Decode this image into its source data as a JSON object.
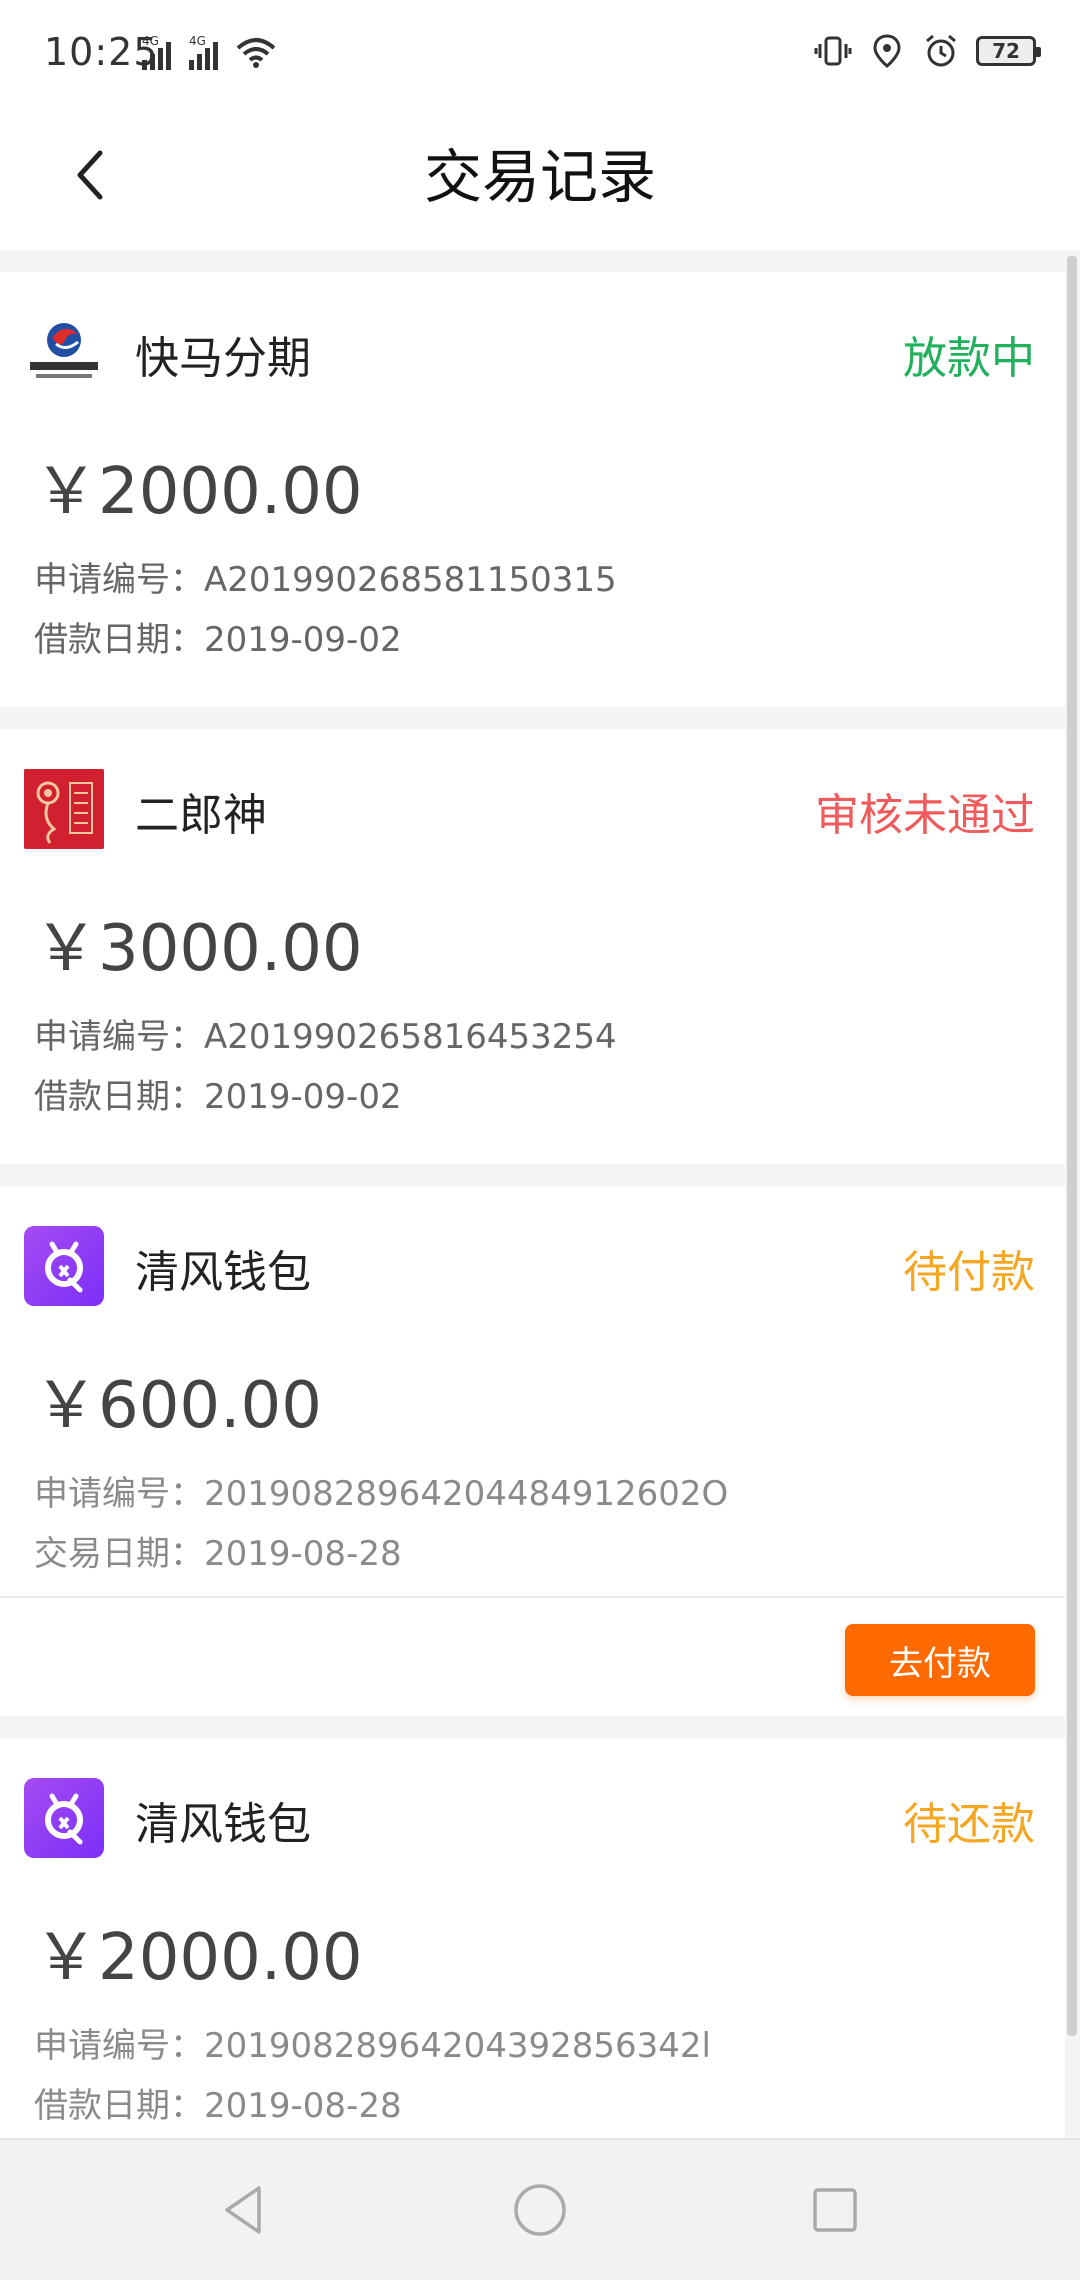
{
  "status_bar": {
    "time": "10:25",
    "sim1_label": "4G",
    "sim2_label": "4G",
    "battery": "72"
  },
  "header": {
    "title": "交易记录"
  },
  "records": [
    {
      "merchant": "快马分期",
      "status": "放款中",
      "status_color": "#21b05b",
      "amount": "￥2000.00",
      "id_label": "申请编号：",
      "id_value": "A201990268581150315",
      "date_label": "借款日期：",
      "date_value": "2019-09-02",
      "logo_icon": "kuaima-logo-icon",
      "logo_text": "快马分期"
    },
    {
      "merchant": "二郎神",
      "status": "审核未通过",
      "status_color": "#f05a5a",
      "amount": "￥3000.00",
      "id_label": "申请编号：",
      "id_value": "A201990265816453254",
      "date_label": "借款日期：",
      "date_value": "2019-09-02",
      "logo_icon": "erlangshen-logo-icon"
    },
    {
      "merchant": "清风钱包",
      "status": "待付款",
      "status_color": "#f5a623",
      "amount": "￥600.00",
      "id_label": "申请编号：",
      "id_value": "20190828964204484912602O",
      "date_label": "交易日期：",
      "date_value": "2019-08-28",
      "logo_icon": "qingfeng-logo-icon",
      "action_label": "去付款"
    },
    {
      "merchant": "清风钱包",
      "status": "待还款",
      "status_color": "#f5a623",
      "amount": "￥2000.00",
      "id_label": "申请编号：",
      "id_value": "20190828964204392856342l",
      "date_label": "借款日期：",
      "date_value": "2019-08-28",
      "logo_icon": "qingfeng-logo-icon"
    }
  ],
  "nav": {
    "back_icon": "triangle-back-icon",
    "home_icon": "circle-home-icon",
    "recent_icon": "square-recent-icon"
  }
}
